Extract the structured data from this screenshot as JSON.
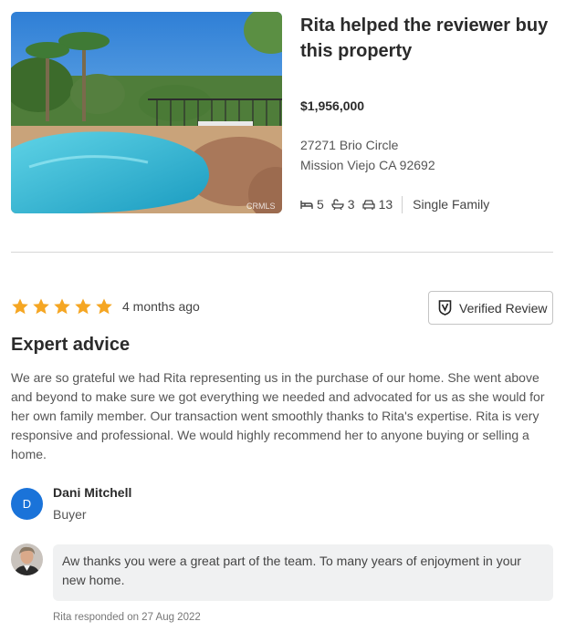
{
  "property": {
    "title": "Rita helped the reviewer buy this property",
    "price": "$1,956,000",
    "address_line1": "27271 Brio Circle",
    "address_line2": "Mission Viejo CA 92692",
    "beds": "5",
    "baths": "3",
    "garages": "13",
    "type": "Single Family",
    "photo_watermark": "CRMLS"
  },
  "review": {
    "rating": 5,
    "time_ago": "4 months ago",
    "verified_label": "Verified Review",
    "heading": "Expert advice",
    "text": "We are so grateful we had Rita representing us in the purchase of our home. She went above and beyond to make sure we got everything we needed and advocated for us as she would for her own family member.  Our transaction went smoothly thanks to Rita's expertise.  Rita is very responsive and professional. We would highly recommend her to anyone buying or selling a home.",
    "reviewer": {
      "initial": "D",
      "name": "Dani Mitchell",
      "role": "Buyer"
    }
  },
  "response": {
    "text": "Aw thanks you were a great part of the team. To many years of enjoyment in your new home.",
    "meta": "Rita responded on 27 Aug 2022"
  },
  "colors": {
    "star": "#f5a623",
    "avatar_bg": "#1a73d9",
    "response_bg": "#f0f1f2"
  },
  "icons": [
    "bed-icon",
    "bath-icon",
    "car-icon",
    "verified-shield-icon",
    "star-icon"
  ]
}
